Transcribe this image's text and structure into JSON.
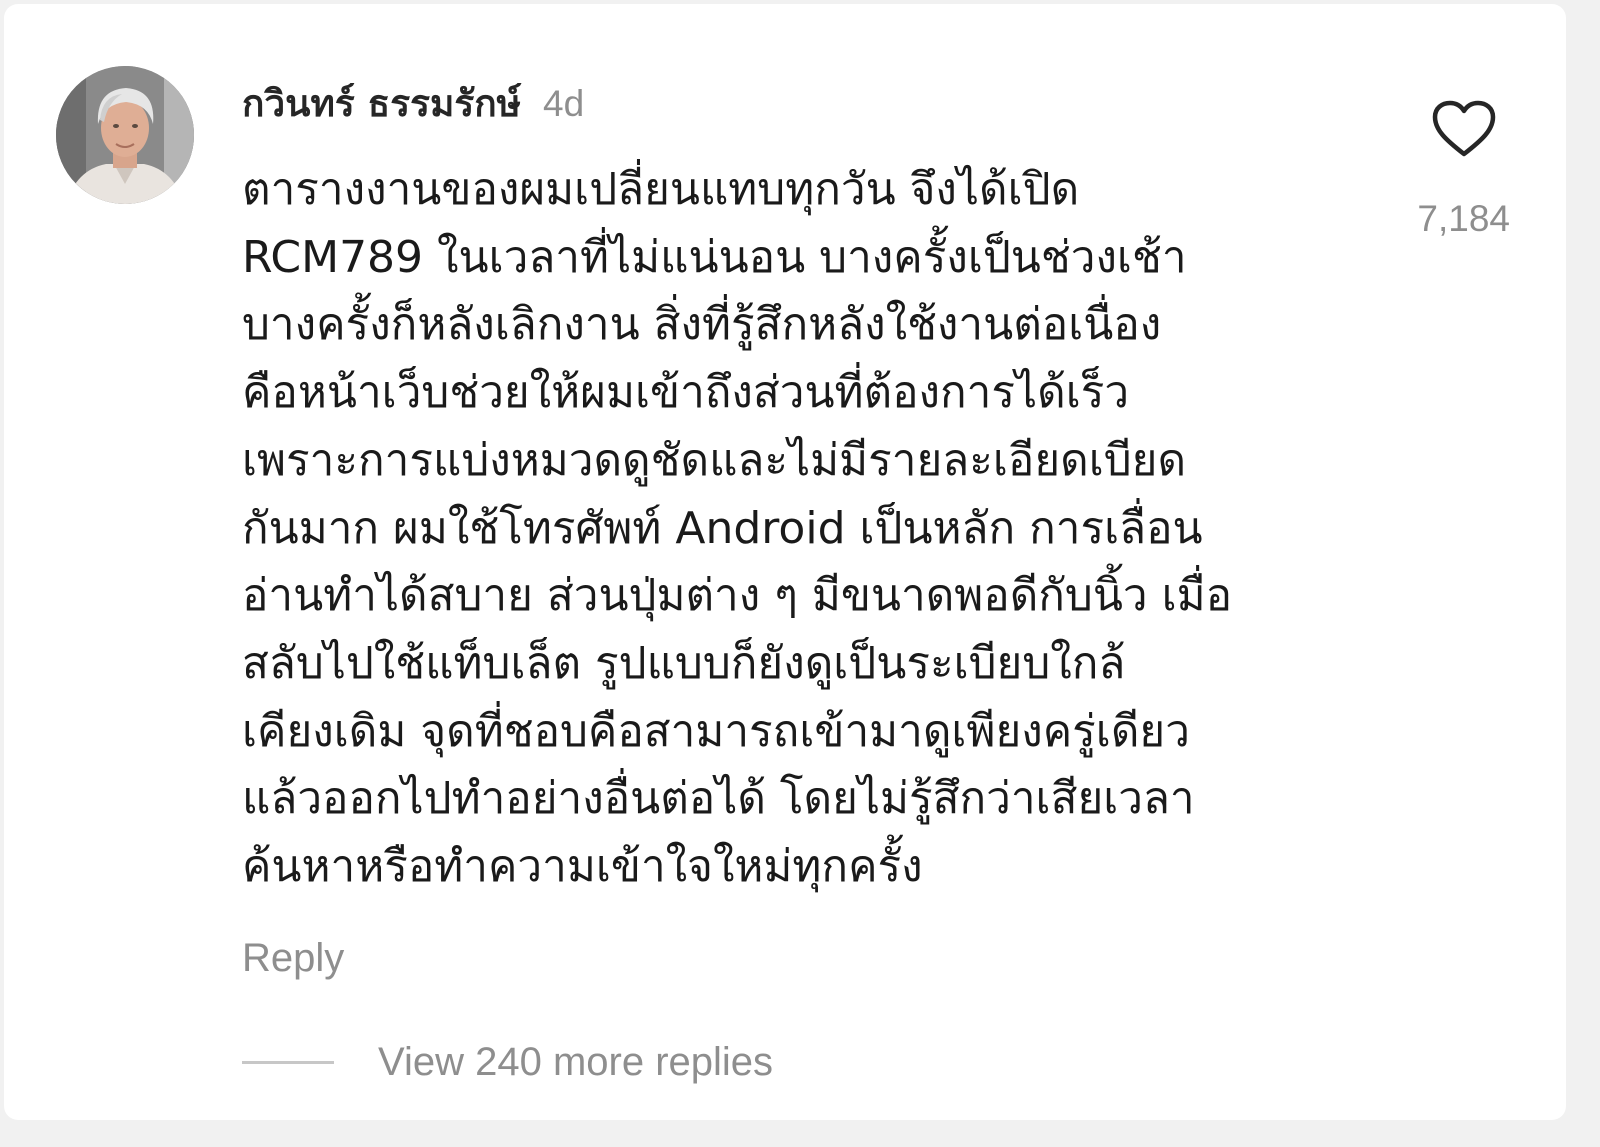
{
  "comment": {
    "author": "กวินทร์ ธรรมรักษ์",
    "timestamp": "4d",
    "lines": [
      "ตารางงานของผมเปลี่ยนแทบทุกวัน จึงได้เปิด",
      "RCM789 ในเวลาที่ไม่แน่นอน บางครั้งเป็นช่วงเช้า",
      "บางครั้งก็หลังเลิกงาน สิ่งที่รู้สึกหลังใช้งานต่อเนื่อง",
      "คือหน้าเว็บช่วยให้ผมเข้าถึงส่วนที่ต้องการได้เร็ว",
      "เพราะการแบ่งหมวดดูชัดและไม่มีรายละเอียดเบียด",
      "กันมาก ผมใช้โทรศัพท์ Android เป็นหลัก การเลื่อน",
      "อ่านทำได้สบาย ส่วนปุ่มต่าง ๆ มีขนาดพอดีกับนิ้ว เมื่อ",
      "สลับไปใช้แท็บเล็ต รูปแบบก็ยังดูเป็นระเบียบใกล้",
      "เคียงเดิม จุดที่ชอบคือสามารถเข้ามาดูเพียงครู่เดียว",
      "แล้วออกไปทำอย่างอื่นต่อได้ โดยไม่รู้สึกว่าเสียเวลา",
      "ค้นหาหรือทำความเข้าใจใหม่ทุกครั้ง"
    ],
    "like_count": "7,184",
    "reply_label": "Reply",
    "view_replies_label": "View 240 more replies"
  },
  "icons": {
    "like": "heart-outline-icon",
    "avatar": "user-avatar"
  },
  "colors": {
    "text_primary": "#262626",
    "text_secondary": "#8e8e8e",
    "background": "#ffffff"
  }
}
